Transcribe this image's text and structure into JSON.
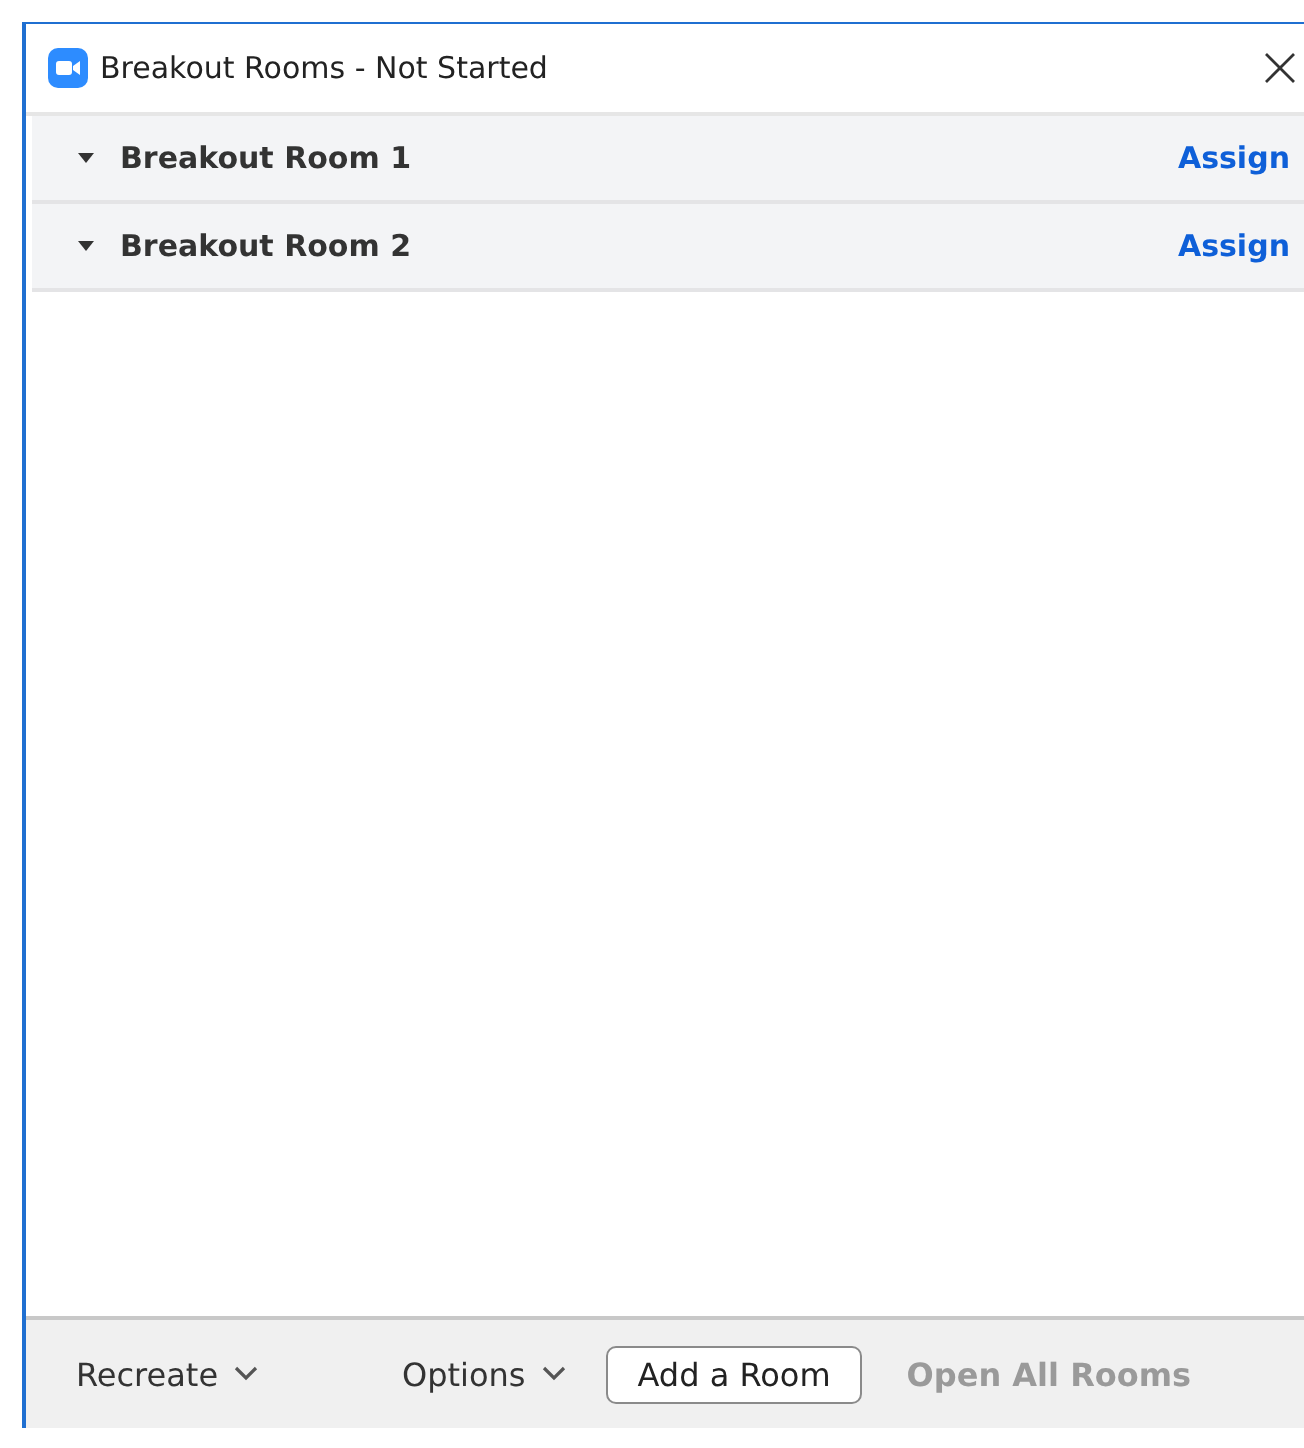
{
  "window": {
    "title": "Breakout Rooms - Not Started"
  },
  "rooms": [
    {
      "name": "Breakout Room 1",
      "expanded": true,
      "action": "Assign"
    },
    {
      "name": "Breakout Room 2",
      "expanded": true,
      "action": "Assign"
    }
  ],
  "footer": {
    "recreate": "Recreate",
    "options": "Options",
    "add_room": "Add a Room",
    "open_all": {
      "label": "Open All Rooms",
      "disabled": true
    }
  }
}
